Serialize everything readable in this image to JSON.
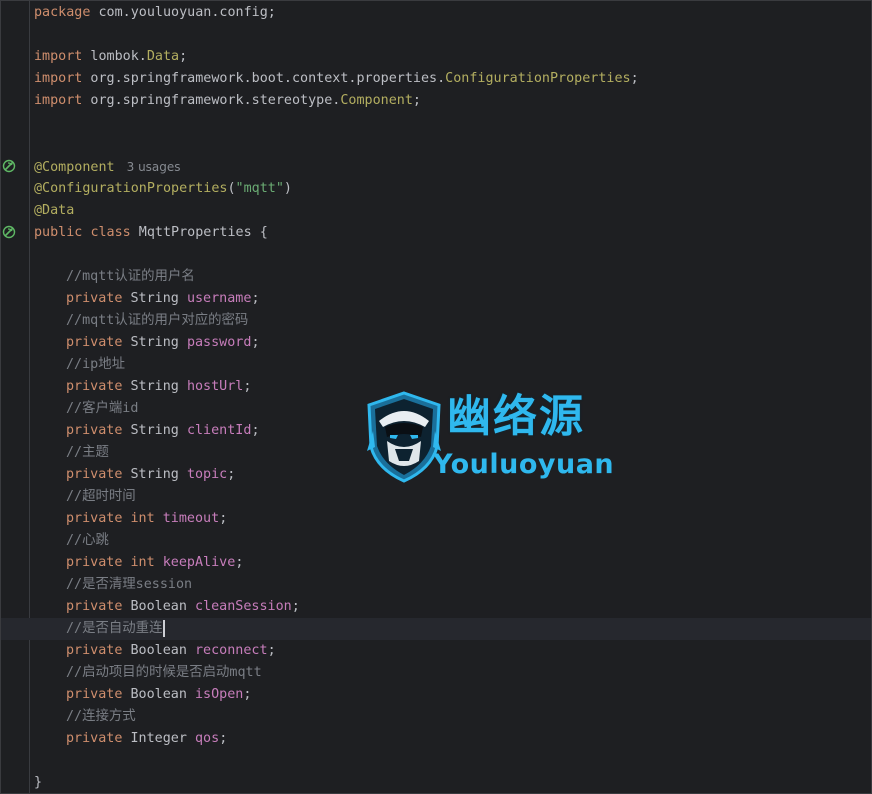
{
  "editor": {
    "package_line": {
      "kw": "package",
      "rest": " com.youluoyuan.config;"
    },
    "imports": [
      {
        "kw": "import",
        "pre": " lombok.",
        "cls": "Data",
        "post": ";"
      },
      {
        "kw": "import",
        "pre": " org.springframework.boot.context.properties.",
        "cls": "ConfigurationProperties",
        "post": ";"
      },
      {
        "kw": "import",
        "pre": " org.springframework.stereotype.",
        "cls": "Component",
        "post": ";"
      }
    ],
    "annotation_component": "@Component",
    "usages_hint": "3 usages",
    "annotation_config": "@ConfigurationProperties",
    "annotation_config_open": "(",
    "annotation_config_arg": "\"mqtt\"",
    "annotation_config_close": ")",
    "annotation_data": "@Data",
    "class_decl": {
      "kw1": "public",
      "kw2": "class",
      "name": " MqttProperties {"
    },
    "fields": [
      {
        "comment": "//mqtt认证的用户名",
        "mod": "private",
        "type": " String ",
        "name": "username",
        "end": ";"
      },
      {
        "comment": "//mqtt认证的用户对应的密码",
        "mod": "private",
        "type": " String ",
        "name": "password",
        "end": ";"
      },
      {
        "comment": "//ip地址",
        "mod": "private",
        "type": " String ",
        "name": "hostUrl",
        "end": ";"
      },
      {
        "comment": "//客户端id",
        "mod": "private",
        "type": " String ",
        "name": "clientId",
        "end": ";"
      },
      {
        "comment": "//主题",
        "mod": "private",
        "type": " String ",
        "name": "topic",
        "end": ";"
      },
      {
        "comment": "//超时时间",
        "mod": "private",
        "type": " ",
        "type_kw": "int",
        "type_post": " ",
        "name": "timeout",
        "end": ";"
      },
      {
        "comment": "//心跳",
        "mod": "private",
        "type": " ",
        "type_kw": "int",
        "type_post": " ",
        "name": "keepAlive",
        "end": ";"
      },
      {
        "comment": "//是否清理session",
        "mod": "private",
        "type": " Boolean ",
        "name": "cleanSession",
        "end": ";"
      },
      {
        "comment": "//是否自动重连",
        "mod": "private",
        "type": " Boolean ",
        "name": "reconnect",
        "end": ";"
      },
      {
        "comment": "//启动项目的时候是否启动mqtt",
        "mod": "private",
        "type": " Boolean ",
        "name": "isOpen",
        "end": ";"
      },
      {
        "comment": "//连接方式",
        "mod": "private",
        "type": " Integer ",
        "name": "qos",
        "end": ";"
      }
    ],
    "closing_brace": "}"
  },
  "watermark": {
    "title": "幽络源",
    "subtitle": "Youluoyuan"
  },
  "colors": {
    "background": "#1e1f22",
    "keyword": "#cf8e6d",
    "annotation": "#b3ae60",
    "field": "#c77dbb",
    "string": "#6aab73",
    "comment": "#7a7e85",
    "text": "#bcbec4",
    "watermark": "#2fb8ee"
  }
}
